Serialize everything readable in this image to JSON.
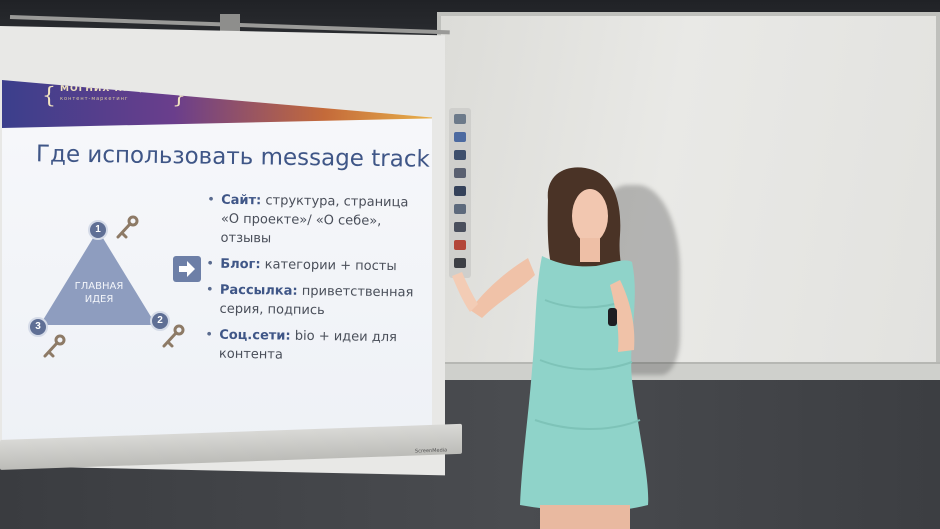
{
  "slide": {
    "banner_line1": "МОГНИХ ПРОДАЖ",
    "banner_line2": "контент-маркетинг",
    "title": "Где использовать message track",
    "triangle_label_line1": "ГЛАВНАЯ",
    "triangle_label_line2": "ИДЕЯ",
    "numbers": [
      "1",
      "2",
      "3"
    ],
    "bullets": [
      {
        "head": "Сайт:",
        "text": " структура, страница «О проекте»/ «О себе», отзывы"
      },
      {
        "head": "Блог:",
        "text": " категории + посты"
      },
      {
        "head": "Рассылка:",
        "text": " приветственная серия, подпись"
      },
      {
        "head": "Соц.сети:",
        "text": " bio + идеи для контента"
      }
    ]
  },
  "screen_brand": "ScreenMedia",
  "colors": {
    "title": "#3f5687",
    "body_text": "#4a4f5a",
    "triangle": "#7f8fb5",
    "dress": "#8fd3c9"
  }
}
